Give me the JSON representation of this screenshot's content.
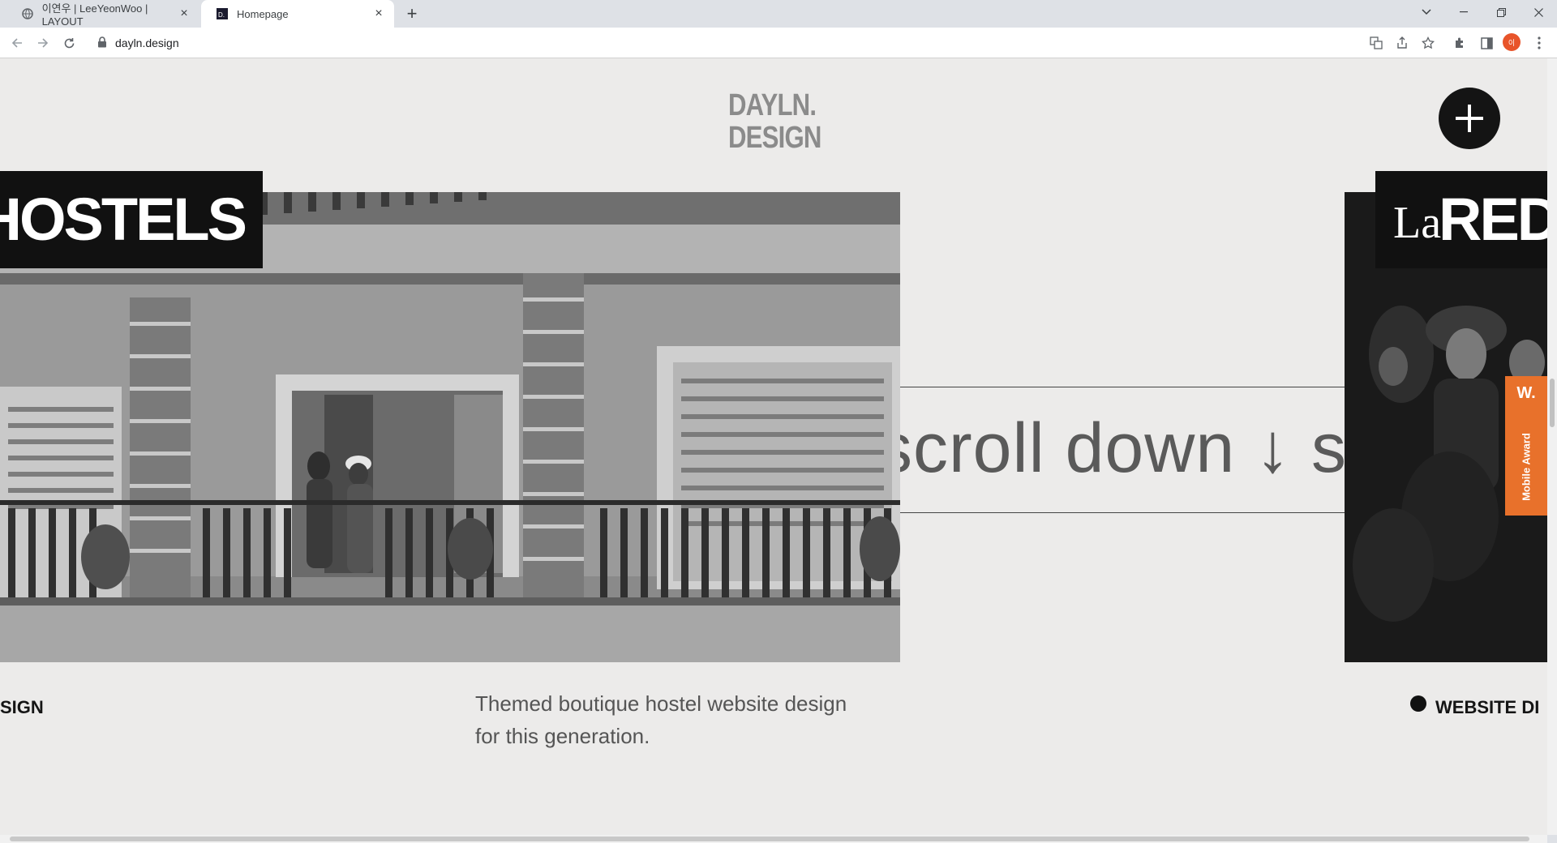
{
  "browser": {
    "tabs": [
      {
        "label": "이연우 | LeeYeonWoo | LAYOUT",
        "active": false
      },
      {
        "label": "Homepage",
        "active": true
      }
    ],
    "url": "dayln.design"
  },
  "page": {
    "logo_line1": "DAYLN.",
    "logo_line2": "DESIGN",
    "left_card": {
      "title": "E HOSTELS",
      "caption": "SIGN"
    },
    "marquee_text": "scroll down ↓ scr",
    "description_line1": "Themed boutique hostel website design",
    "description_line2": "for this generation.",
    "right_card": {
      "title_prefix": "La",
      "title_main": "REDE",
      "caption": "WEBSITE DI"
    },
    "award": {
      "badge": "W.",
      "label": "Mobile Award",
      "color": "#e8712b"
    }
  }
}
